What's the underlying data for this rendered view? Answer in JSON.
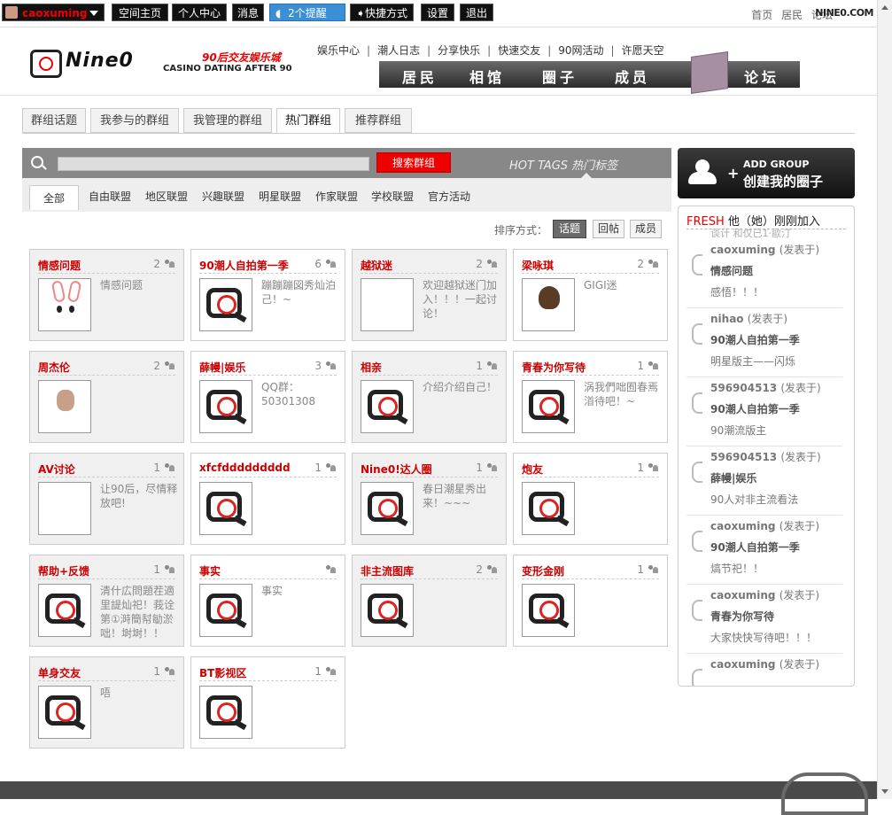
{
  "topbar": {
    "username": "caoxuming",
    "buttons": [
      "空间主页",
      "个人中心",
      "消息",
      "2个提醒",
      "快捷方式",
      "设置",
      "退出"
    ],
    "right_links": [
      "首页",
      "居民",
      "论坛"
    ],
    "brand": "NINE0.COM"
  },
  "header": {
    "logo_text": "Nine0",
    "logo_tagline1": "90后交友娱乐城",
    "logo_tagline2": "CASINO DATING AFTER 90",
    "links": [
      "娱乐中心",
      "潮人日志",
      "分享快乐",
      "快速交友",
      "90网活动",
      "许愿天空"
    ],
    "nav": [
      "居民",
      "相馆",
      "圈子",
      "成员",
      "论坛"
    ]
  },
  "tabs": [
    {
      "label": "群组话题",
      "active": false
    },
    {
      "label": "我参与的群组",
      "active": false
    },
    {
      "label": "我管理的群组",
      "active": false
    },
    {
      "label": "热门群组",
      "active": true
    },
    {
      "label": "推荐群组",
      "active": false
    }
  ],
  "search": {
    "placeholder": "",
    "button": "搜索群组",
    "hot_tags": "HOT TAGS 热门标签"
  },
  "categories": [
    "全部",
    "自由联盟",
    "地区联盟",
    "兴趣联盟",
    "明星联盟",
    "作家联盟",
    "学校联盟",
    "官方活动"
  ],
  "sort": {
    "label": "排序方式：",
    "options": [
      {
        "label": "话题",
        "active": true
      },
      {
        "label": "回帖",
        "active": false
      },
      {
        "label": "成员",
        "active": false
      }
    ]
  },
  "groups": [
    {
      "name": "情感问题",
      "count": "2",
      "desc": "情感问题",
      "image": "bunny"
    },
    {
      "name": "90潮人自拍第一季",
      "count": "6",
      "desc": "蹦蹦蹦図秀灿泊己！~",
      "image": "default"
    },
    {
      "name": "越狱迷",
      "count": "2",
      "desc": "欢迎越狱迷门加入！！！一起讨论！",
      "image": "movie"
    },
    {
      "name": "梁咏琪",
      "count": "2",
      "desc": "GIGI迷",
      "image": "girl"
    },
    {
      "name": "周杰伦",
      "count": "2",
      "desc": "",
      "image": "man"
    },
    {
      "name": "薛幔|娱乐",
      "count": "3",
      "desc": "QQ群：50301308",
      "image": "default"
    },
    {
      "name": "相亲",
      "count": "1",
      "desc": "介绍介绍自己！",
      "image": "default"
    },
    {
      "name": "青春为你写待",
      "count": "1",
      "desc": "涡我們咄囿春焉渞待吧！~",
      "image": "default"
    },
    {
      "name": "AV讨论",
      "count": "1",
      "desc": "让90后，尽情释放吧!",
      "image": "kanji"
    },
    {
      "name": "xfcfddddddddd",
      "count": "1",
      "desc": "",
      "image": "default"
    },
    {
      "name": "Nine0!达人圈",
      "count": "1",
      "desc": "春日潮星秀出来！~~~",
      "image": "default"
    },
    {
      "name": "炮友",
      "count": "1",
      "desc": "",
      "image": "default"
    },
    {
      "name": "帮助+反馈",
      "count": "1",
      "desc": "清什広問題茬適里諟灿祀！莪诠第①溡簡幇勄淤咄！埘埘！！",
      "image": "default"
    },
    {
      "name": "事实",
      "count": "",
      "desc": "事实",
      "image": "default"
    },
    {
      "name": "非主流图库",
      "count": "2",
      "desc": "",
      "image": "default"
    },
    {
      "name": "变形金刚",
      "count": "1",
      "desc": "",
      "image": "default"
    },
    {
      "name": "单身交友",
      "count": "1",
      "desc": "唔",
      "image": "default"
    },
    {
      "name": "BT影视区",
      "count": "1",
      "desc": "",
      "image": "default"
    }
  ],
  "sidebar": {
    "add_en": "ADD GROUP",
    "add_cn": "创建我的圈子",
    "fresh_red": "FRESH",
    "fresh_title": " 他（她）刚刚加入",
    "cut_line": "谈计  和仅已1·歐汀",
    "posted_label": "(发表于)",
    "feed": [
      {
        "user": "caoxuming",
        "group": "情感问题",
        "msg": "感悟！！！"
      },
      {
        "user": "nihao",
        "group": "90潮人自拍第一季",
        "msg": "明星版主——闪烁"
      },
      {
        "user": "596904513",
        "group": "90潮人自拍第一季",
        "msg": "90潮流版主"
      },
      {
        "user": "596904513",
        "group": "薛幔|娱乐",
        "msg": "90人对非主流看法"
      },
      {
        "user": "caoxuming",
        "group": "90潮人自拍第一季",
        "msg": "熇节祀！！"
      },
      {
        "user": "caoxuming",
        "group": "青春为你写待",
        "msg": "大家快快写待吧！！！"
      },
      {
        "user": "caoxuming",
        "group": "",
        "msg": ""
      }
    ]
  },
  "colors": {
    "accent": "#cc0000",
    "alert": "#3a8fd6",
    "dark": "#111111"
  }
}
